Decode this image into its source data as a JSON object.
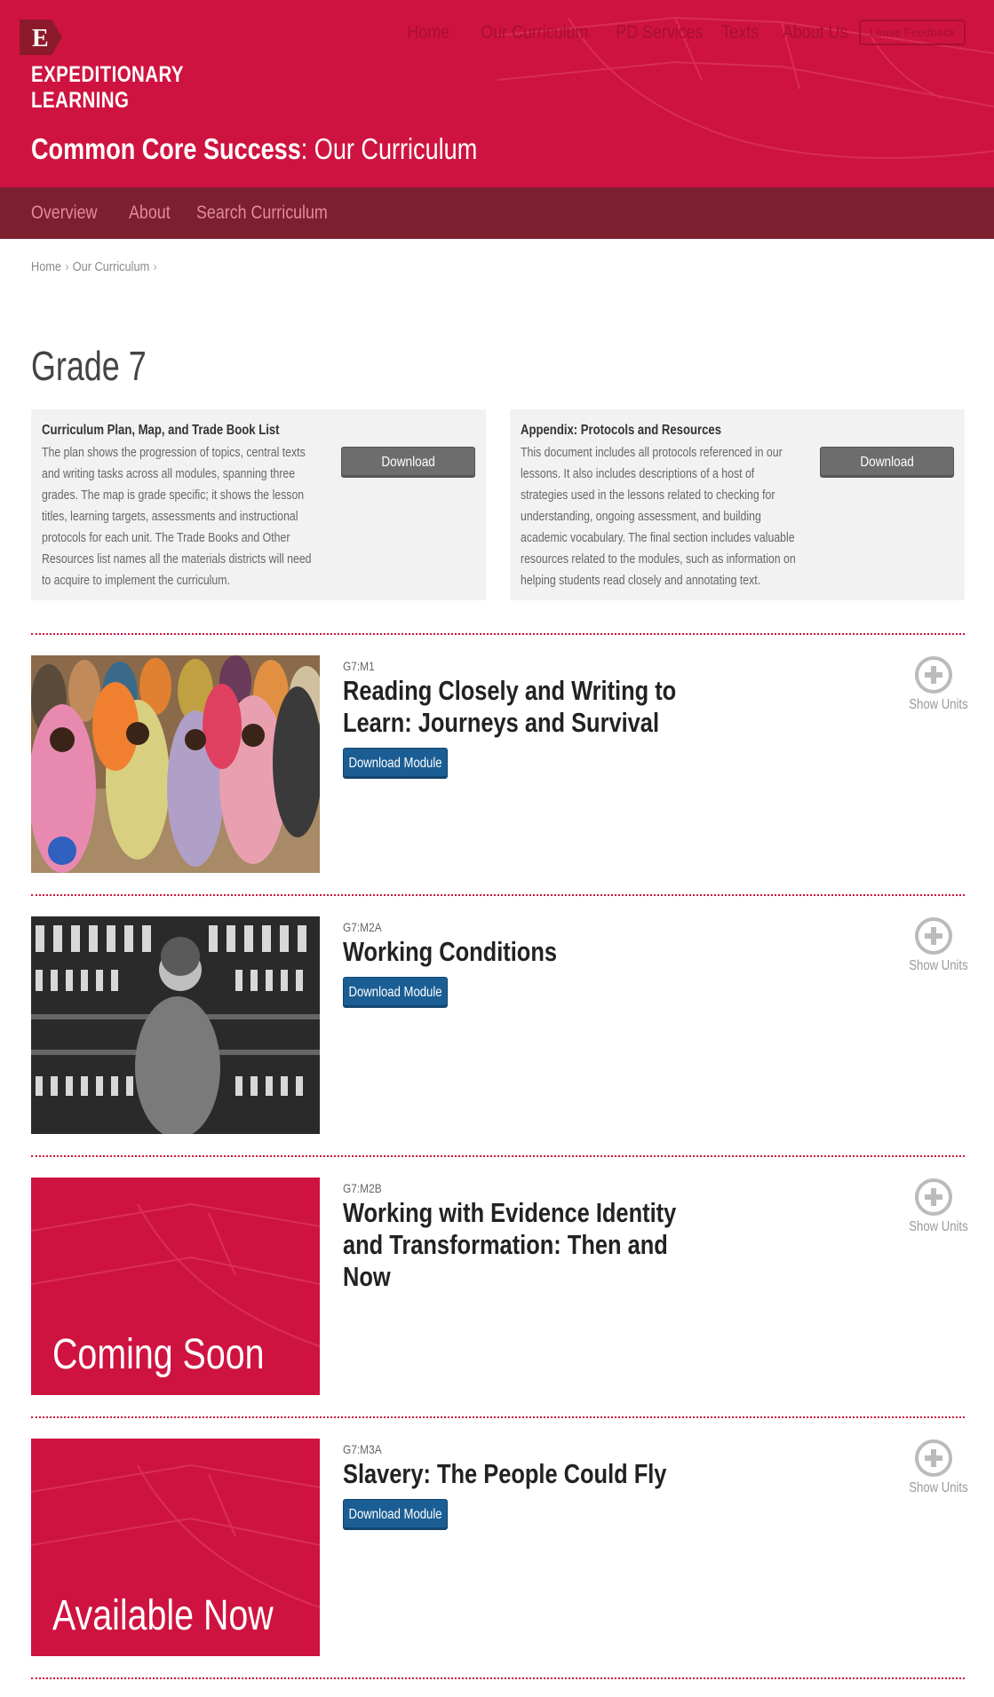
{
  "header": {
    "logo_letter": "E",
    "logo_line1": "EXPEDITIONARY",
    "logo_line2": "LEARNING",
    "title_bold": "Common Core Success",
    "title_rest": ": Our Curriculum",
    "nav": [
      "Home",
      "Our Curriculum",
      "PD Services",
      "Texts",
      "About Us"
    ],
    "feedback_label": "Leave Feedback",
    "bg_color": "#cf1340"
  },
  "subnav": {
    "items": [
      "Overview",
      "About",
      "Search Curriculum"
    ],
    "bg_color": "#7c1f2f"
  },
  "breadcrumb": {
    "items": [
      "Home",
      "Our Curriculum"
    ],
    "separator": "›"
  },
  "page_title": "Grade 7",
  "documents": [
    {
      "title": "Curriculum Plan, Map, and Trade Book List",
      "body": "The plan shows the progression of topics, central texts and writing tasks across all modules, spanning three grades. The map is grade specific; it shows the lesson titles, learning targets, assessments and instructional protocols for each unit. The Trade Books and Other Resources list names all the materials districts will need to acquire to implement the curriculum.",
      "button": "Download"
    },
    {
      "title": "Appendix: Protocols and Resources",
      "body": "This document includes all protocols referenced in our lessons. It also includes descriptions of a host of strategies used in the lessons related to checking for understanding, ongoing assessment, and building academic vocabulary. The final section includes valuable resources related to the modules, such as information on helping students read closely and annotating text.",
      "button": "Download"
    }
  ],
  "modules": [
    {
      "code": "G7:M1",
      "title": "Reading Closely and Writing to Learn: Journeys and Survival",
      "download": "Download Module",
      "show_units": "Show Units"
    },
    {
      "code": "G7:M2A",
      "title": "Working Conditions",
      "download": "Download Module",
      "show_units": "Show Units"
    },
    {
      "code": "G7:M2B",
      "title": "Working with Evidence Identity and Transformation: Then and Now",
      "promo": "Coming Soon",
      "show_units": "Show Units"
    },
    {
      "code": "G7:M3A",
      "title": "Slavery: The People Could Fly",
      "download": "Download Module",
      "promo": "Available Now",
      "show_units": "Show Units"
    }
  ],
  "colors": {
    "accent": "#cf1340",
    "button_blue": "#1b5e94",
    "button_gray": "#6d6d6d"
  }
}
